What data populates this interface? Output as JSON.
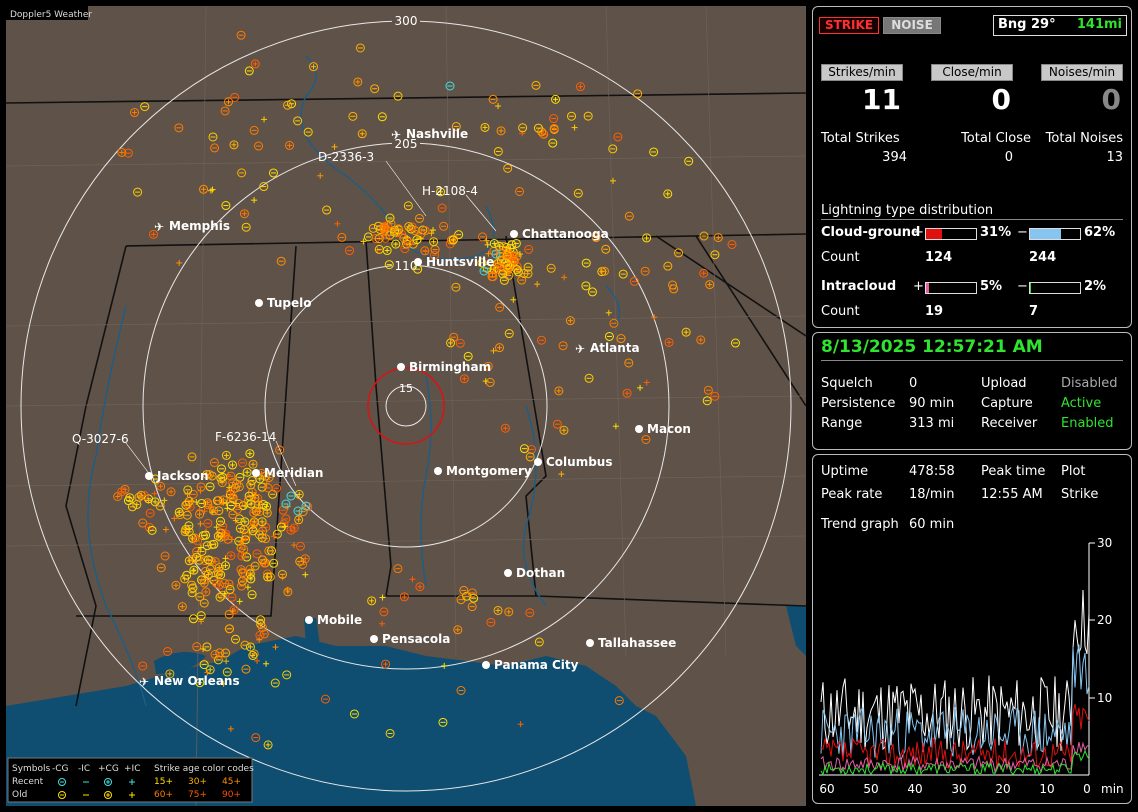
{
  "map": {
    "title": "Doppler5 Weather",
    "range_rings": [
      "300",
      "205",
      "110",
      "15"
    ],
    "cities": [
      {
        "name": "Nashville",
        "kind": "airport"
      },
      {
        "name": "Memphis",
        "kind": "airport"
      },
      {
        "name": "Chattanooga",
        "kind": "city"
      },
      {
        "name": "Huntsville",
        "kind": "city"
      },
      {
        "name": "Tupelo",
        "kind": "city"
      },
      {
        "name": "Atlanta",
        "kind": "airport"
      },
      {
        "name": "Birmingham",
        "kind": "city"
      },
      {
        "name": "Macon",
        "kind": "city"
      },
      {
        "name": "Jackson",
        "kind": "city"
      },
      {
        "name": "Meridian",
        "kind": "city"
      },
      {
        "name": "Montgomery",
        "kind": "city"
      },
      {
        "name": "Columbus",
        "kind": "city"
      },
      {
        "name": "Dothan",
        "kind": "city"
      },
      {
        "name": "Mobile",
        "kind": "city"
      },
      {
        "name": "Pensacola",
        "kind": "city"
      },
      {
        "name": "Tallahassee",
        "kind": "city"
      },
      {
        "name": "Panama City",
        "kind": "city"
      },
      {
        "name": "New Orleans",
        "kind": "airport"
      }
    ],
    "stations": [
      "D-2336-3",
      "H-2108-4",
      "Q-3027-6",
      "F-6236-14"
    ],
    "legend": {
      "symbols_label": "Symbols",
      "columns": [
        "-CG",
        "-IC",
        "+CG",
        "+IC"
      ],
      "age_title": "Strike age color codes",
      "recent_label": "Recent",
      "old_label": "Old",
      "recent_ages": [
        "15+",
        "30+",
        "45+"
      ],
      "old_ages": [
        "60+",
        "75+",
        "90+"
      ]
    }
  },
  "panel": {
    "mode_strike": "STRIKE",
    "mode_noise": "NOISE",
    "bearing": "Bng 29°",
    "distance": "141mi",
    "rates": [
      {
        "label": "Strikes/min",
        "value": "11"
      },
      {
        "label": "Close/min",
        "value": "0"
      },
      {
        "label": "Noises/min",
        "value": "0"
      }
    ],
    "totals": [
      {
        "label": "Total Strikes",
        "value": "394"
      },
      {
        "label": "Total Close",
        "value": "0"
      },
      {
        "label": "Total Noises",
        "value": "13"
      }
    ],
    "dist_title": "Lightning type distribution",
    "cloud_ground": {
      "label": "Cloud-ground",
      "pos_pct": "31%",
      "neg_pct": "62%",
      "pos_frac": 0.31,
      "neg_frac": 0.62,
      "count_label": "Count",
      "pos_count": "124",
      "neg_count": "244"
    },
    "intracloud": {
      "label": "Intracloud",
      "pos_pct": "5%",
      "neg_pct": "2%",
      "pos_frac": 0.05,
      "neg_frac": 0.02,
      "count_label": "Count",
      "pos_count": "19",
      "neg_count": "7"
    },
    "plus": "+",
    "minus": "−",
    "datetime": "8/13/2025 12:57:21 AM",
    "settings": [
      {
        "label": "Squelch",
        "value": "0",
        "label2": "Upload",
        "value2": "Disabled",
        "status2": "gray"
      },
      {
        "label": "Persistence",
        "value": "90 min",
        "label2": "Capture",
        "value2": "Active",
        "status2": "green"
      },
      {
        "label": "Range",
        "value": "313 mi",
        "label2": "Receiver",
        "value2": "Enabled",
        "status2": "green"
      }
    ],
    "uptime_label": "Uptime",
    "uptime": "478:58",
    "peak_time_label": "Peak time",
    "plot_label": "Plot",
    "peak_rate_label": "Peak rate",
    "peak_rate": "18/min",
    "peak_time": "12:55 AM",
    "plot": "Strike",
    "trend_label": "Trend graph",
    "trend_value": "60 min",
    "graph_y_ticks": [
      "30",
      "20",
      "10"
    ],
    "graph_x_ticks": [
      "60",
      "50",
      "40",
      "30",
      "20",
      "10",
      "0"
    ],
    "graph_x_unit": "min"
  },
  "colors": {
    "land": "#5f5249",
    "water": "#0f4e70",
    "accent_green": "#2fe32f",
    "positive_red": "#e01010",
    "negative_blue": "#86c5f0"
  }
}
